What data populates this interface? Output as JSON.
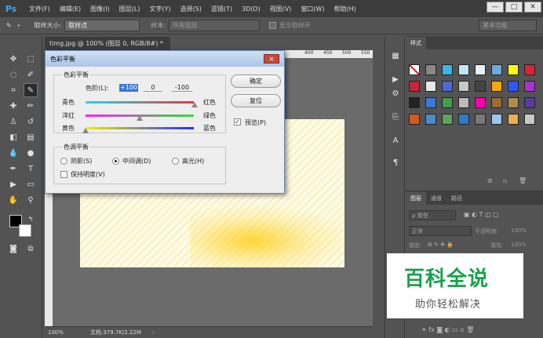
{
  "app": {
    "logo": "Ps"
  },
  "menu": [
    "文件(F)",
    "编辑(E)",
    "图像(I)",
    "图层(L)",
    "文字(Y)",
    "选择(S)",
    "滤镜(T)",
    "3D(D)",
    "视图(V)",
    "窗口(W)",
    "帮助(H)"
  ],
  "window_controls": {
    "minimize": "—",
    "maximize": "□",
    "close": "✕"
  },
  "options_bar": {
    "sample_size_label": "取样大小:",
    "sample_size_value": "取样点",
    "sample_label": "样本:",
    "sample_value": "所有图层",
    "show_ring_label": "显示取样环",
    "workspace": "基本功能"
  },
  "document": {
    "tab_title": "timg.jpg @ 100% (图层 0, RGB/8#) *",
    "zoom": "100%",
    "doc_info": "文档:379.7K/2.22M",
    "ruler_ticks": [
      "400",
      "450",
      "500",
      "550",
      "600",
      "650"
    ]
  },
  "dialog": {
    "title": "色彩平衡",
    "group_color_balance": "色彩平衡",
    "levels_label": "色阶(L):",
    "levels_values": [
      "+100",
      "0",
      "-100"
    ],
    "sliders": [
      {
        "left": "青色",
        "right": "红色",
        "value": 100
      },
      {
        "left": "洋红",
        "right": "绿色",
        "value": 0
      },
      {
        "left": "黄色",
        "right": "蓝色",
        "value": -100
      }
    ],
    "group_tone": "色调平衡",
    "tones": [
      {
        "label": "阴影(S)",
        "selected": false
      },
      {
        "label": "中间调(D)",
        "selected": true
      },
      {
        "label": "高光(H)",
        "selected": false
      }
    ],
    "preserve_luminosity": "保持明度(V)",
    "preserve_checked": false,
    "ok": "确定",
    "reset": "复位",
    "preview": "预览(P)",
    "preview_checked": true
  },
  "styles_panel": {
    "tab": "样式"
  },
  "layers_panel": {
    "tabs": [
      "图层",
      "通道",
      "路径"
    ],
    "filter_kind": "ρ 类型",
    "blend_mode": "正常",
    "opacity_label": "不透明度:",
    "opacity_value": "100%",
    "lock_label": "锁定:",
    "fill_label": "填充:",
    "fill_value": "100%"
  },
  "watermark": {
    "title": "百科全说",
    "subtitle": "助你轻松解决"
  },
  "colors": {
    "accent": "#31a8ff",
    "selection": "#3b76d6",
    "watermark_green": "#16a34a"
  }
}
